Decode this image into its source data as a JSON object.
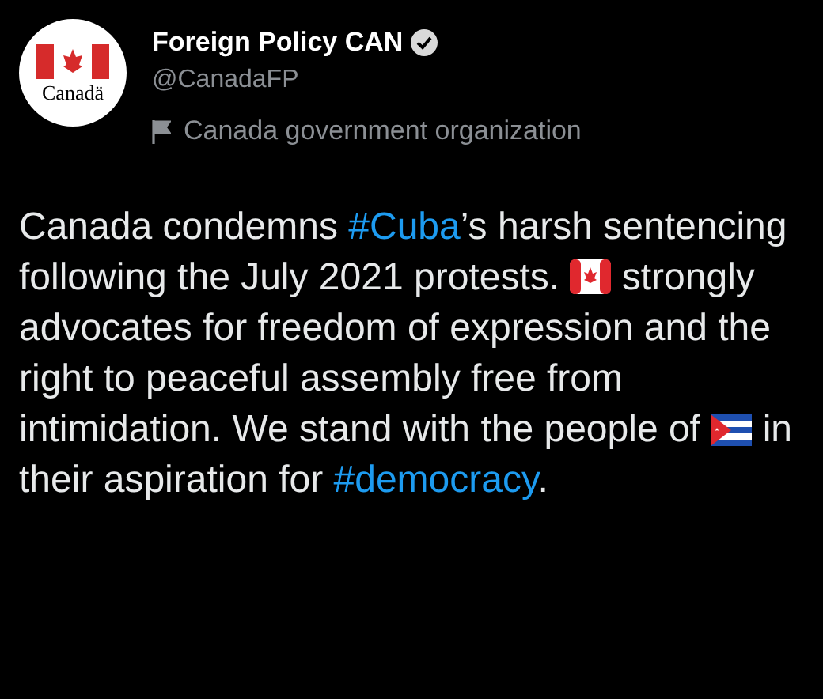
{
  "author": {
    "avatar_wordmark": "Canadä",
    "name": "Foreign Policy CAN",
    "verified": true,
    "handle": "@CanadaFP",
    "label": "Canada government organization"
  },
  "body": [
    {
      "kind": "text",
      "text": "Canada condemns "
    },
    {
      "kind": "hashtag",
      "text": "#Cuba"
    },
    {
      "kind": "text",
      "text": "’s harsh sentencing following the July 2021 protests. "
    },
    {
      "kind": "canadaflag"
    },
    {
      "kind": "text",
      "text": " strongly advocates for freedom of expression and the right to peaceful assembly free from intimidation. We stand with the people of "
    },
    {
      "kind": "cubaflag"
    },
    {
      "kind": "text",
      "text": " in their aspiration for "
    },
    {
      "kind": "hashtag",
      "text": "#democracy"
    },
    {
      "kind": "text",
      "text": "."
    }
  ]
}
